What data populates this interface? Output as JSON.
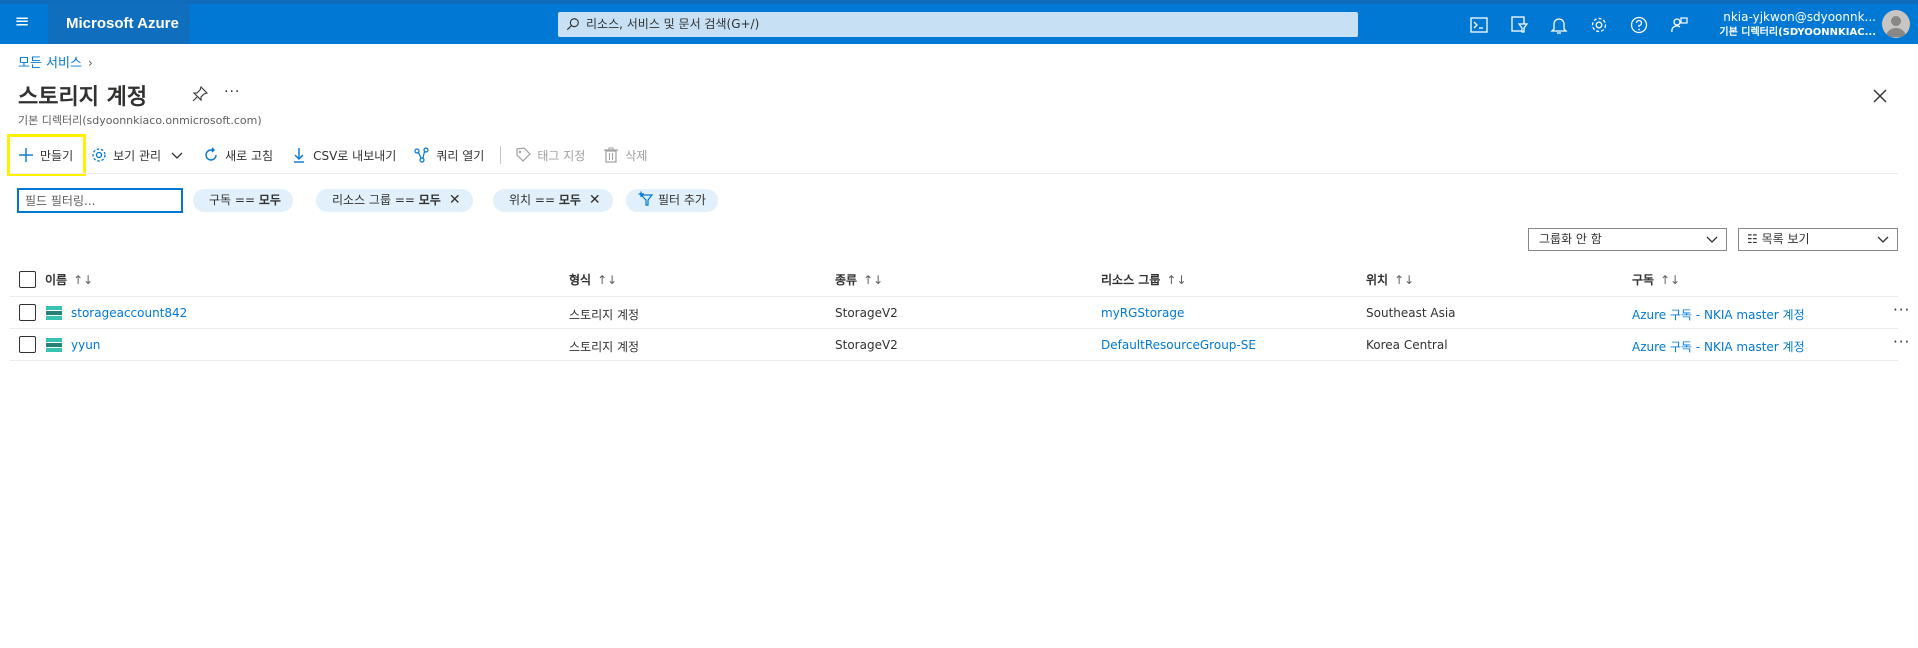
{
  "topbar": {
    "brand": "Microsoft Azure",
    "search_placeholder": "리소스, 서비스 및 문서 검색(G+/)",
    "user_email": "nkia-yjkwon@sdyoonnk...",
    "user_directory": "기본 디렉터리(SDYOONNKIAC...",
    "icons": [
      "cloud-shell-icon",
      "directory-filter-icon",
      "notifications-icon",
      "settings-icon",
      "help-icon",
      "feedback-icon"
    ]
  },
  "header": {
    "breadcrumb": "모든 서비스",
    "title": "스토리지 계정",
    "subtitle": "기본 디렉터리(sdyoonnkiaco.onmicrosoft.com)"
  },
  "toolbar": {
    "create": "만들기",
    "manage_view": "보기 관리",
    "refresh": "새로 고침",
    "export_csv": "CSV로 내보내기",
    "open_query": "쿼리 열기",
    "assign_tags": "태그 지정",
    "delete": "삭제"
  },
  "filters": {
    "placeholder": "필드 필터링...",
    "subscription_label": "구독 == ",
    "subscription_value": "모두",
    "resource_group_label": "리소스 그룹 == ",
    "resource_group_value": "모두",
    "location_label": "위치 == ",
    "location_value": "모두",
    "add_filter": "필터 추가"
  },
  "view_options": {
    "grouping": "그룹화 안 함",
    "view": "☷ 목록 보기"
  },
  "table": {
    "columns": [
      "이름",
      "형식",
      "종류",
      "리소스 그룹",
      "위치",
      "구독"
    ],
    "sort_glyph": "↑↓",
    "rows": [
      {
        "name": "storageaccount842",
        "type": "스토리지 계정",
        "kind": "StorageV2",
        "resource_group": "myRGStorage",
        "location": "Southeast Asia",
        "subscription": "Azure 구독 - NKIA master 계정"
      },
      {
        "name": "yyun",
        "type": "스토리지 계정",
        "kind": "StorageV2",
        "resource_group": "DefaultResourceGroup-SE",
        "location": "Korea Central",
        "subscription": "Azure 구독 - NKIA master 계정"
      }
    ]
  },
  "colors": {
    "azure_blue": "#0078d4",
    "highlight": "#fff100",
    "pill_bg": "#e1f0fb"
  }
}
